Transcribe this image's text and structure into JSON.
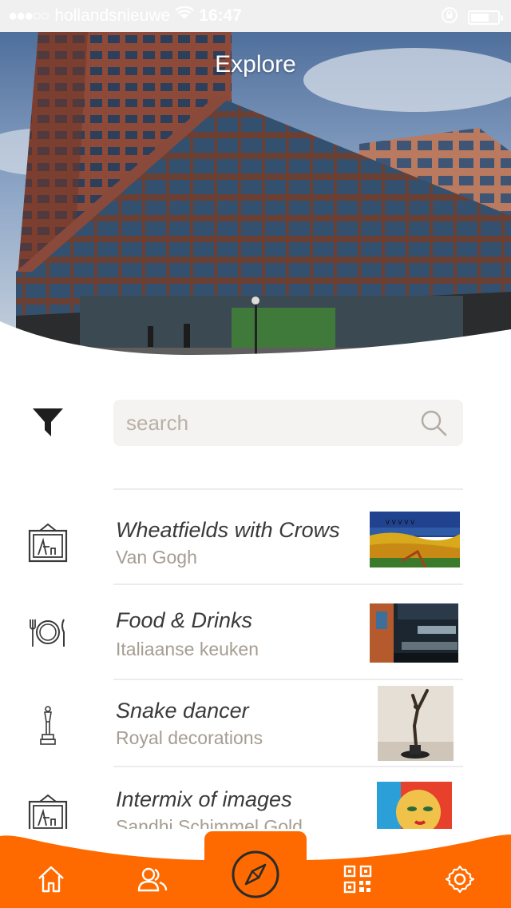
{
  "status_bar": {
    "carrier": "hollandsnieuwe",
    "time": "16:47",
    "signal_dots": "●●●○○"
  },
  "header": {
    "title": "Explore"
  },
  "search": {
    "placeholder": "search"
  },
  "list": [
    {
      "title": "Wheatfields with Crows",
      "subtitle": "Van Gogh",
      "icon": "painting-icon",
      "thumb": "wheatfield-thumbnail"
    },
    {
      "title": "Food & Drinks",
      "subtitle": "Italiaanse keuken",
      "icon": "plate-cutlery-icon",
      "thumb": "restaurant-thumbnail"
    },
    {
      "title": "Snake dancer",
      "subtitle": "Royal decorations",
      "icon": "statue-icon",
      "thumb": "statue-thumbnail"
    },
    {
      "title": "Intermix of images",
      "subtitle": "Sandhi Schimmel Gold",
      "icon": "painting-icon",
      "thumb": "mosaic-face-thumbnail"
    }
  ],
  "tabbar": {
    "items": [
      "home-icon",
      "people-icon",
      "compass-icon",
      "qr-code-icon",
      "gear-icon"
    ],
    "active": "compass-icon"
  },
  "colors": {
    "accent": "#ff6a00",
    "title_text": "#3a3a3a",
    "subtitle_text": "#a69d92",
    "search_bg": "#f4f3f1"
  }
}
